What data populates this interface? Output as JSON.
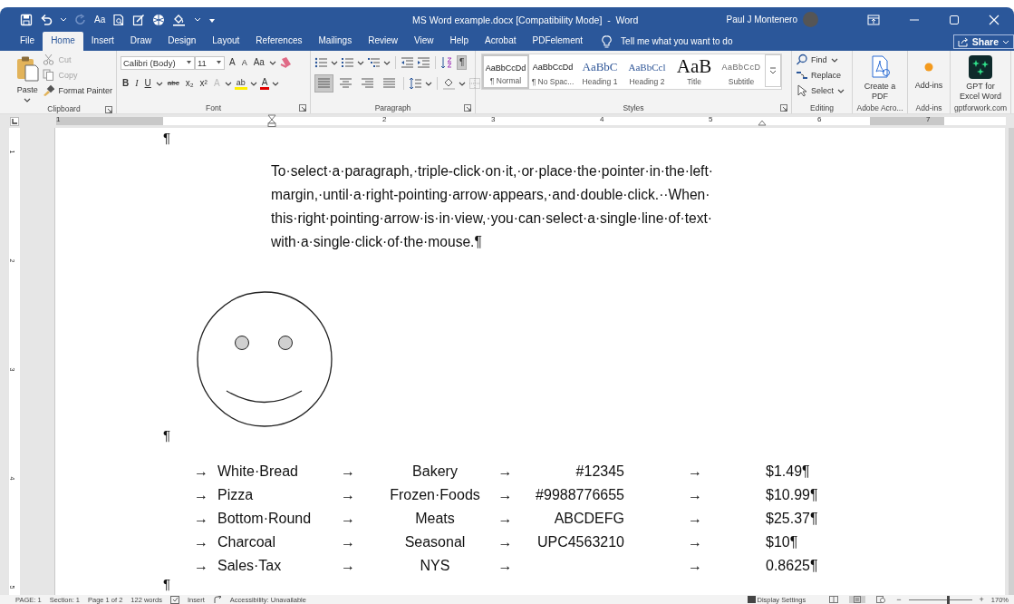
{
  "title_bar": {
    "quick_access_text": "Aa",
    "title": "MS Word example.docx [Compatibility Mode]  -  Word",
    "user": "Paul J Montenero"
  },
  "tabs": [
    {
      "label": "File",
      "selected": false
    },
    {
      "label": "Home",
      "selected": true
    },
    {
      "label": "Insert",
      "selected": false
    },
    {
      "label": "Draw",
      "selected": false
    },
    {
      "label": "Design",
      "selected": false
    },
    {
      "label": "Layout",
      "selected": false
    },
    {
      "label": "References",
      "selected": false
    },
    {
      "label": "Mailings",
      "selected": false
    },
    {
      "label": "Review",
      "selected": false
    },
    {
      "label": "View",
      "selected": false
    },
    {
      "label": "Help",
      "selected": false
    },
    {
      "label": "Acrobat",
      "selected": false
    },
    {
      "label": "PDFelement",
      "selected": false
    }
  ],
  "tell_me": "Tell me what you want to do",
  "share": "Share",
  "clipboard": {
    "paste": "Paste",
    "items": [
      {
        "kind": "cut",
        "label": "Cut",
        "disabled": true
      },
      {
        "kind": "copy",
        "label": "Copy",
        "disabled": true
      },
      {
        "kind": "painter",
        "label": "Format Painter",
        "disabled": false
      }
    ],
    "group": "Clipboard"
  },
  "font": {
    "name": "Calibri (Body)",
    "size": "11",
    "tools": [
      {
        "kind": "grow",
        "label": "A"
      },
      {
        "kind": "shrink",
        "label": "A"
      },
      {
        "kind": "case",
        "label": "Aa"
      },
      {
        "kind": "clear"
      }
    ],
    "format": [
      {
        "kind": "bold",
        "label": "B"
      },
      {
        "kind": "italic",
        "label": "I"
      },
      {
        "kind": "underline",
        "label": "U"
      },
      {
        "kind": "strike",
        "label": "abc"
      },
      {
        "kind": "sub",
        "label": "x₂"
      },
      {
        "kind": "sup",
        "label": "x²"
      },
      {
        "kind": "effects",
        "label": "A"
      },
      {
        "kind": "highlight",
        "label": "ab"
      },
      {
        "kind": "color",
        "label": "A"
      }
    ],
    "group": "Font"
  },
  "paragraph": {
    "row1": [
      {
        "kind": "bullets"
      },
      {
        "kind": "numbering"
      },
      {
        "kind": "multilevel"
      },
      {
        "kind": "outdent"
      },
      {
        "kind": "indent"
      },
      {
        "kind": "sort"
      },
      {
        "kind": "marks",
        "label": "¶",
        "on": true
      }
    ],
    "row2": [
      {
        "kind": "left",
        "selected": true
      },
      {
        "kind": "center",
        "selected": false
      },
      {
        "kind": "right",
        "selected": false
      },
      {
        "kind": "justify",
        "selected": false
      },
      {
        "kind": "spacing"
      },
      {
        "kind": "shading"
      },
      {
        "kind": "borders"
      }
    ],
    "group": "Paragraph"
  },
  "styles": {
    "items": [
      {
        "kind": "normal",
        "preview": "AaBbCcDd",
        "name": "¶ Normal",
        "selected": true
      },
      {
        "kind": "normal",
        "preview": "AaBbCcDd",
        "name": "¶ No Spac...",
        "selected": false
      },
      {
        "kind": "heading",
        "preview": "AaBbC",
        "name": "Heading 1",
        "selected": false
      },
      {
        "kind": "heading2",
        "preview": "AaBbCcl",
        "name": "Heading 2",
        "selected": false
      },
      {
        "kind": "title",
        "preview": "AaB",
        "name": "Title",
        "selected": false
      },
      {
        "kind": "subtitle",
        "preview": "AaBbCcD",
        "name": "Subtitle",
        "selected": false
      }
    ],
    "group": "Styles"
  },
  "editing": {
    "items": [
      {
        "kind": "find",
        "label": "Find"
      },
      {
        "kind": "replace",
        "label": "Replace"
      },
      {
        "kind": "select",
        "label": "Select"
      }
    ],
    "group": "Editing"
  },
  "extra_groups": [
    {
      "kind": "pdf",
      "label": "Create a PDF",
      "group": "Adobe Acro..."
    },
    {
      "kind": "addins",
      "label": "Add-ins",
      "group": "Add-ins"
    },
    {
      "kind": "gpt",
      "label": "GPT for Excel Word",
      "group": "gptforwork.com"
    }
  ],
  "ruler": {
    "labels": [
      "1",
      "2",
      "3",
      "4",
      "5",
      "6",
      "7"
    ],
    "vertical_labels": [
      "1",
      "2",
      "3",
      "4",
      "5"
    ]
  },
  "document": {
    "mark_top": "¶",
    "paragraph": [
      "To·select·a·paragraph,·triple-click·on·it,·or·place·the·pointer·in·the·left·",
      "margin,·until·a·right-pointing·arrow·appears,·and·double·click.··When·",
      "this·right·pointing·arrow·is·in·view,·you·can·select·a·single·line·of·text·",
      "with·a·single·click·of·the·mouse.¶"
    ],
    "mark_middle": "¶",
    "rows": [
      {
        "cells": [
          "→",
          "White·Bread",
          "→",
          "Bakery",
          "→",
          "#12345",
          "→",
          "$1.49¶"
        ]
      },
      {
        "cells": [
          "→",
          "Pizza",
          "→",
          "Frozen·Foods",
          "→",
          "#9988776655",
          "→",
          "$10.99¶"
        ]
      },
      {
        "cells": [
          "→",
          "Bottom·Round",
          "→",
          "Meats",
          "→",
          "ABCDEFG",
          "→",
          "$25.37¶"
        ]
      },
      {
        "cells": [
          "→",
          "Charcoal",
          "→",
          "Seasonal",
          "→",
          "UPC4563210",
          "→",
          "$10¶"
        ]
      },
      {
        "cells": [
          "→",
          "Sales·Tax",
          "→",
          "NYS",
          "→",
          "",
          "→",
          "0.8625¶"
        ]
      }
    ],
    "mark_bottom": "¶"
  },
  "status_bar": {
    "items": [
      "PAGE: 1",
      "Section: 1",
      "Page 1 of 2",
      "122 words",
      "Insert",
      "Accessibility: Unavailable"
    ],
    "display_settings": "Display Settings",
    "views": [
      {
        "kind": "read",
        "selected": false
      },
      {
        "kind": "print",
        "selected": true
      },
      {
        "kind": "web",
        "selected": false
      }
    ],
    "zoom_out": "−",
    "zoom_in": "+",
    "zoom": {
      "level": 0.6
    },
    "zoom_text": "170%"
  }
}
